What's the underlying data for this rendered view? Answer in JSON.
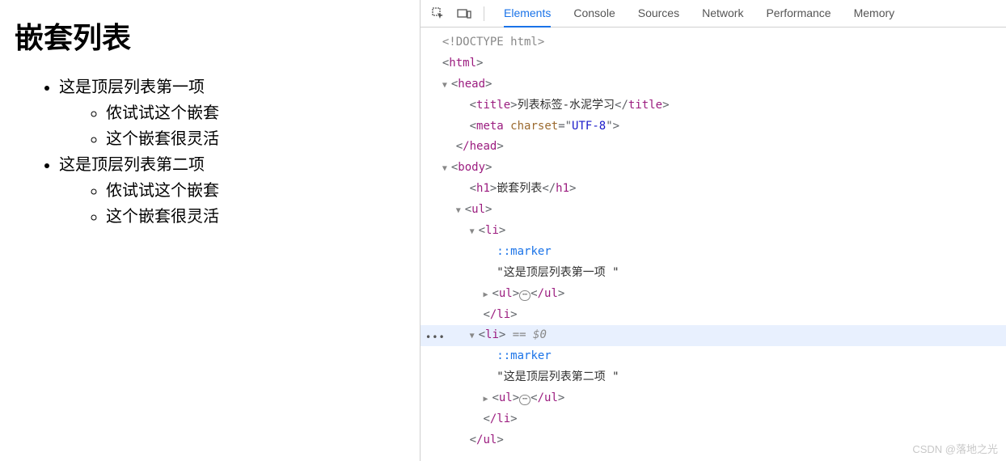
{
  "page": {
    "heading": "嵌套列表",
    "list": [
      {
        "text": "这是顶层列表第一项",
        "sub": [
          "侬试试这个嵌套",
          "这个嵌套很灵活"
        ]
      },
      {
        "text": "这是顶层列表第二项",
        "sub": [
          "侬试试这个嵌套",
          "这个嵌套很灵活"
        ]
      }
    ]
  },
  "devtools": {
    "tabs": [
      "Elements",
      "Console",
      "Sources",
      "Network",
      "Performance",
      "Memory"
    ],
    "active_tab": 0,
    "dom": {
      "doctype": "<!DOCTYPE html>",
      "html_open": "html",
      "head_open": "head",
      "title_tag": "title",
      "title_text": "列表标签-水泥学习",
      "meta_tag": "meta",
      "meta_attr": "charset",
      "meta_val": "UTF-8",
      "head_close": "/head",
      "body_open": "body",
      "h1_tag": "h1",
      "h1_text": "嵌套列表",
      "ul_tag": "ul",
      "li_tag": "li",
      "marker": "::marker",
      "li1_text": "\"这是顶层列表第一项 \"",
      "li2_text": "\"这是顶层列表第二项 \"",
      "ul_close": "/ul",
      "li_close": "/li",
      "selected_eq": " == $0"
    }
  },
  "watermark": "CSDN @落地之光"
}
